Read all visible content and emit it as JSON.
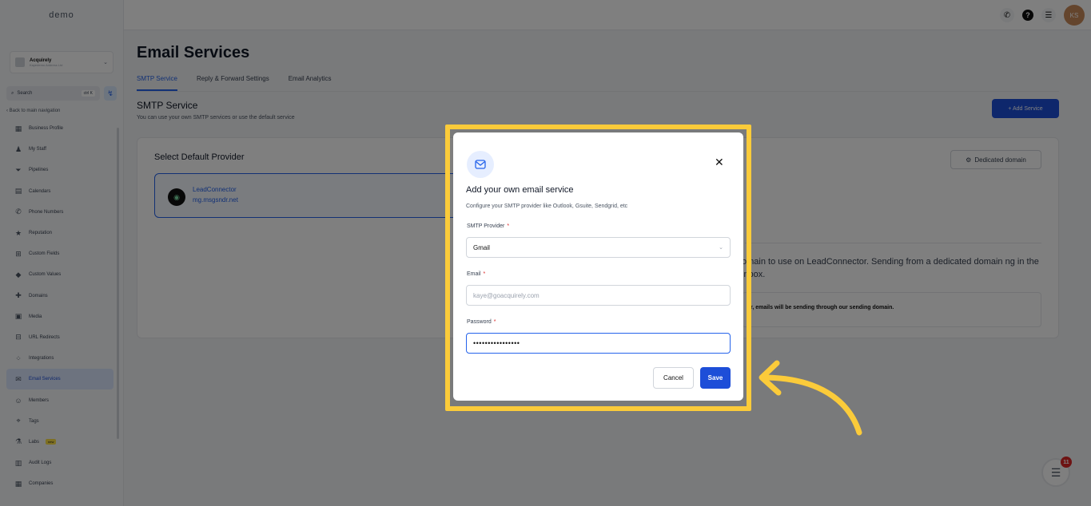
{
  "sidebar": {
    "logo": "demo",
    "account": {
      "name": "Acquirely",
      "sub": "Kayedemo Address Ltd"
    },
    "search": {
      "label": "Search",
      "shortcut": "ctrl K"
    },
    "back_link": "Back to main navigation",
    "items": [
      {
        "label": "Business Profile",
        "icon": "building-icon"
      },
      {
        "label": "My Staff",
        "icon": "user-icon"
      },
      {
        "label": "Pipelines",
        "icon": "funnel-icon"
      },
      {
        "label": "Calendars",
        "icon": "calendar-icon"
      },
      {
        "label": "Phone Numbers",
        "icon": "phone-icon"
      },
      {
        "label": "Reputation",
        "icon": "star-icon"
      },
      {
        "label": "Custom Fields",
        "icon": "fields-icon"
      },
      {
        "label": "Custom Values",
        "icon": "values-icon"
      },
      {
        "label": "Domains",
        "icon": "globe-icon"
      },
      {
        "label": "Media",
        "icon": "media-icon"
      },
      {
        "label": "URL Redirects",
        "icon": "link-icon"
      },
      {
        "label": "Integrations",
        "icon": "plug-icon"
      },
      {
        "label": "Email Services",
        "icon": "email-icon",
        "active": true
      },
      {
        "label": "Members",
        "icon": "members-icon"
      },
      {
        "label": "Tags",
        "icon": "tag-icon"
      },
      {
        "label": "Labs",
        "icon": "labs-icon",
        "badge": "new"
      },
      {
        "label": "Audit Logs",
        "icon": "logs-icon"
      },
      {
        "label": "Companies",
        "icon": "company-icon"
      }
    ]
  },
  "topbar": {
    "avatar": "KS"
  },
  "main": {
    "title": "Email Services",
    "tabs": [
      "SMTP Service",
      "Reply & Forward Settings",
      "Email Analytics"
    ],
    "section_title": "SMTP Service",
    "section_sub": "You can use your own SMTP services or use the default service",
    "add_button": "+ Add Service",
    "card": {
      "title": "Select Default Provider",
      "provider_name": "LeadConnector",
      "provider_domain": "mg.msgsndr.net",
      "dedicated_button": "Dedicated domain",
      "dedicated_text": "omain to use on LeadConnector. Sending from a dedicated domain ng in the inbox.",
      "dedicated_note": "r, emails will be sending through our sending domain."
    }
  },
  "chat": {
    "badge": "11"
  },
  "modal": {
    "title": "Add your own email service",
    "subtitle": "Configure your SMTP provider like Outlook, Gsuite, Sendgrid, etc",
    "smtp_label": "SMTP Provider",
    "smtp_value": "Gmail",
    "email_label": "Email",
    "email_value": "kaye@goacquirely.com",
    "password_label": "Password",
    "password_value": "••••••••••••••••",
    "required_mark": "*",
    "cancel": "Cancel",
    "save": "Save"
  },
  "colors": {
    "accent": "#1d4ed8",
    "highlight": "#fbcb3a",
    "overlay": "rgba(0,0,0,0.5)"
  }
}
